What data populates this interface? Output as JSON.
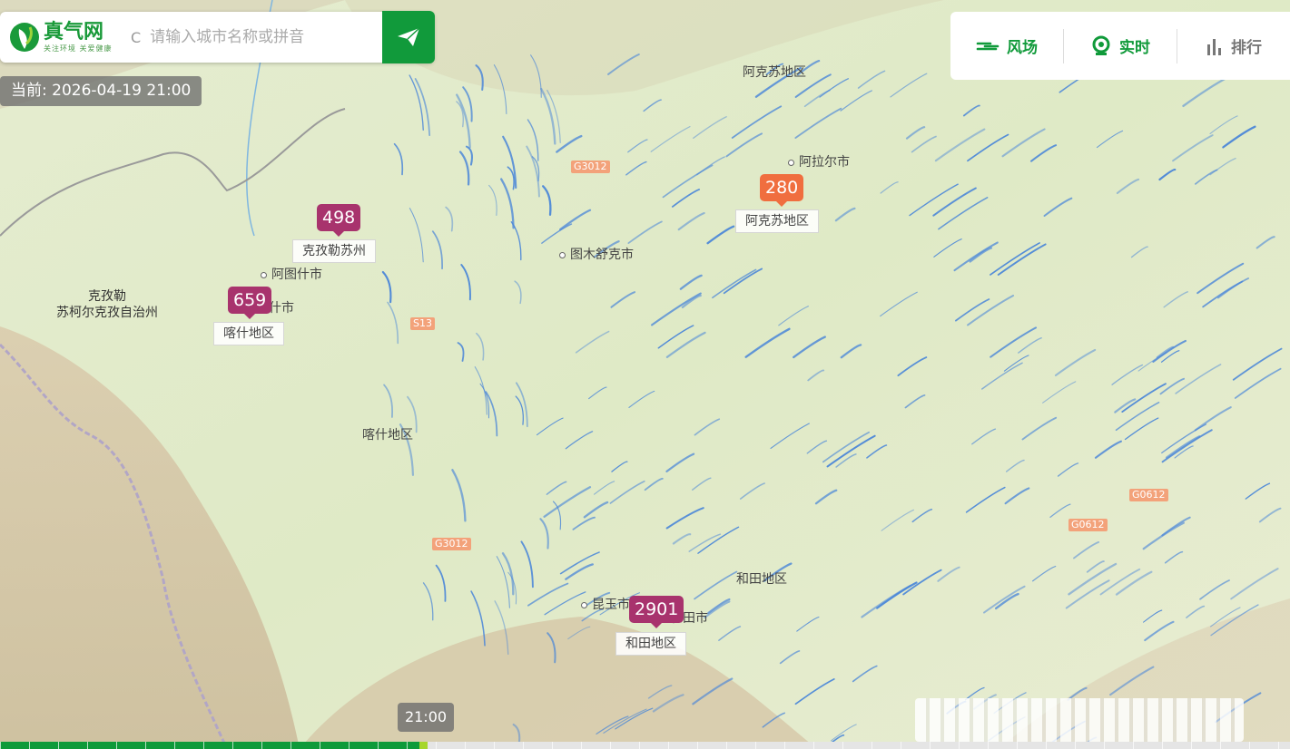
{
  "app": {
    "logo_title": "真气网",
    "logo_subtitle": "关注环境 关爱健康"
  },
  "search": {
    "placeholder": "请输入城市名称或拼音"
  },
  "status": {
    "timestamp": "当前: 2026-04-19 21:00"
  },
  "nav": {
    "wind": "风场",
    "realtime": "实时",
    "ranking": "排行"
  },
  "colors": {
    "brand": "#119a3b",
    "marker_purple": "#a8336d",
    "marker_orange": "#f06e3f",
    "accent_green": "#a6d62a"
  },
  "markers": [
    {
      "value": "498",
      "label": "克孜勒苏州",
      "color": "#a8336d"
    },
    {
      "value": "659",
      "label": "喀什地区",
      "color": "#a8336d"
    },
    {
      "value": "280",
      "label": "阿克苏地区",
      "color": "#f06e3f"
    },
    {
      "value": "2901",
      "label": "和田地区",
      "color": "#a8336d"
    }
  ],
  "places": [
    {
      "name": "阿克苏地区"
    },
    {
      "name": "阿拉尔市"
    },
    {
      "name": "图木舒克市"
    },
    {
      "name": "阿图什市"
    },
    {
      "name": "什市"
    },
    {
      "name": "喀什地区"
    },
    {
      "name": "和田地区"
    },
    {
      "name": "昆玉市"
    },
    {
      "name": "和田市"
    }
  ],
  "region_labels": [
    {
      "line1": "克孜勒",
      "line2": "苏柯尔克孜自治州"
    }
  ],
  "highways": [
    "G3012",
    "S13",
    "G3012",
    "G0612",
    "G0612"
  ],
  "timeline": {
    "current_label": "21:00",
    "progress": 0.328
  }
}
